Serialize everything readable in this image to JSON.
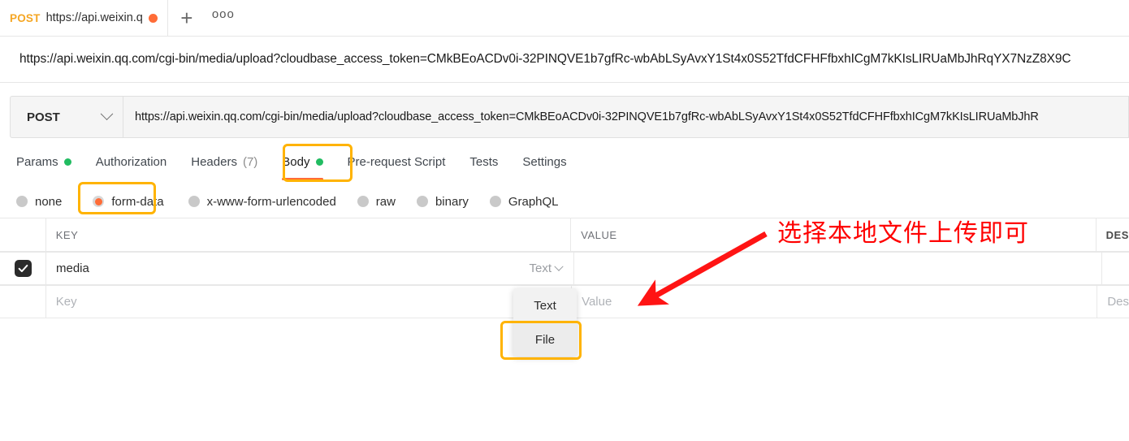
{
  "window": {
    "tab": {
      "method": "POST",
      "name": "https://api.weixin.q",
      "unsaved_icon": "unsaved-dot"
    },
    "new_tab_icon": "plus-icon",
    "more_icon": "ellipsis-icon"
  },
  "full_url_line": "https://api.weixin.qq.com/cgi-bin/media/upload?cloudbase_access_token=CMkBEoACDv0i-32PINQVE1b7gfRc-wbAbLSyAvxY1St4x0S52TfdCFHFfbxhICgM7kKIsLIRUaMbJhRqYX7NzZ8X9C",
  "request": {
    "method": "POST",
    "method_chevron_icon": "chevron-down-icon",
    "url": "https://api.weixin.qq.com/cgi-bin/media/upload?cloudbase_access_token=CMkBEoACDv0i-32PINQVE1b7gfRc-wbAbLSyAvxY1St4x0S52TfdCFHFfbxhICgM7kKIsLIRUaMbJhR"
  },
  "tabs": [
    {
      "label": "Params",
      "dot": true,
      "count": "",
      "active": false
    },
    {
      "label": "Authorization",
      "dot": false,
      "count": "",
      "active": false
    },
    {
      "label": "Headers",
      "dot": false,
      "count": "(7)",
      "active": false
    },
    {
      "label": "Body",
      "dot": true,
      "count": "",
      "active": true
    },
    {
      "label": "Pre-request Script",
      "dot": false,
      "count": "",
      "active": false
    },
    {
      "label": "Tests",
      "dot": false,
      "count": "",
      "active": false
    },
    {
      "label": "Settings",
      "dot": false,
      "count": "",
      "active": false
    }
  ],
  "body_types": [
    {
      "label": "none",
      "selected": false
    },
    {
      "label": "form-data",
      "selected": true
    },
    {
      "label": "x-www-form-urlencoded",
      "selected": false
    },
    {
      "label": "raw",
      "selected": false
    },
    {
      "label": "binary",
      "selected": false
    },
    {
      "label": "GraphQL",
      "selected": false
    }
  ],
  "table": {
    "headers": {
      "key": "KEY",
      "value": "VALUE",
      "description": "DES"
    },
    "rows": [
      {
        "checked": true,
        "key": "media",
        "key_type": "Text",
        "type_chevron_icon": "chevron-down-icon",
        "value": "",
        "description": ""
      },
      {
        "checked": false,
        "key_placeholder": "Key",
        "value_placeholder": "Value",
        "description_placeholder": "Des"
      }
    ]
  },
  "type_dropdown": {
    "items": [
      {
        "label": "Text",
        "highlighted": false
      },
      {
        "label": "File",
        "highlighted": true
      }
    ]
  },
  "annotations": {
    "note_text": "选择本地文件上传即可",
    "note_color": "#ff0000",
    "arrow_icon": "red-arrow-icon",
    "highlight_color": "#ffb300"
  },
  "colors": {
    "accent": "#ff6c37",
    "method": "#f5a623",
    "status_dot": "#21bc61",
    "highlight": "#ffb300",
    "annotation": "#ff0000"
  }
}
